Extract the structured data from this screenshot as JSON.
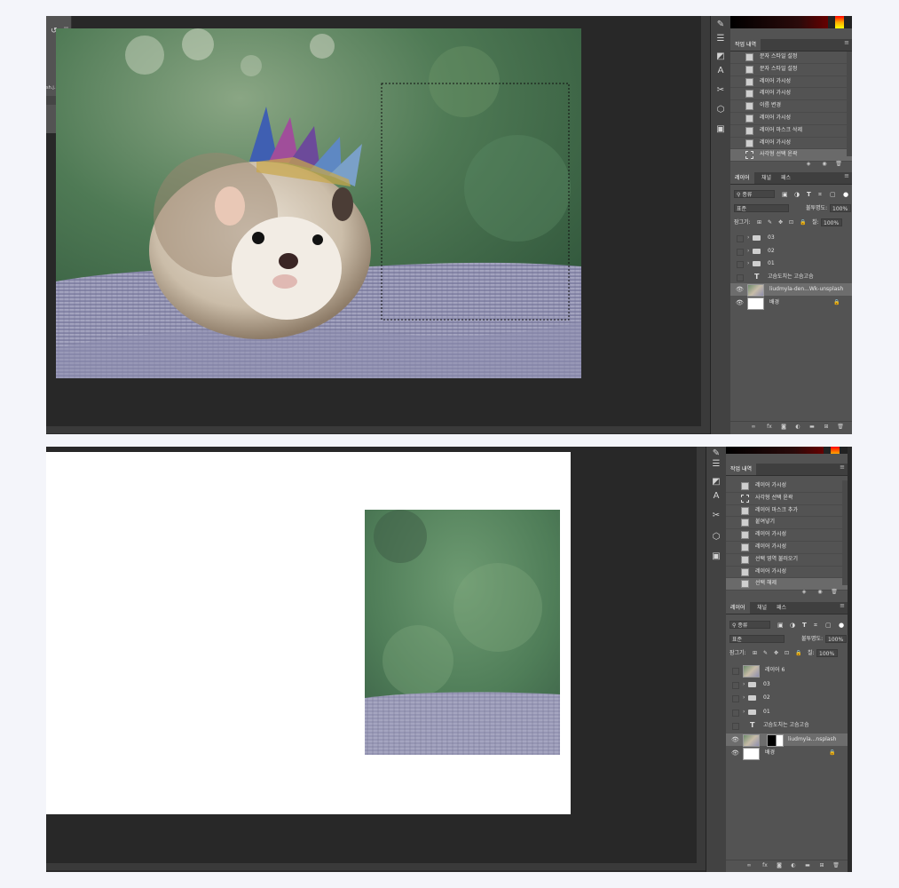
{
  "top": {
    "history_tab": "작업 내역",
    "history_items": [
      {
        "label": "문자 스타일 설정",
        "icon": "layer-icon"
      },
      {
        "label": "문자 스타일 설정",
        "icon": "layer-icon"
      },
      {
        "label": "레이어 가시성",
        "icon": "layer-icon"
      },
      {
        "label": "레이어 가시성",
        "icon": "layer-icon"
      },
      {
        "label": "이름 변경",
        "icon": "layer-icon"
      },
      {
        "label": "레이어 가시성",
        "icon": "layer-icon"
      },
      {
        "label": "레이어 마스크 삭제",
        "icon": "layer-icon"
      },
      {
        "label": "레이어 가시성",
        "icon": "layer-icon"
      },
      {
        "label": "사각형 선택 윤곽",
        "icon": "marquee-icon",
        "active": true
      }
    ],
    "layers_tabs": [
      "레이어",
      "채널",
      "패스"
    ],
    "filter_label": "종류",
    "blend_mode": "표준",
    "opacity_label": "불투명도:",
    "opacity_value": "100%",
    "lock_label": "잠그기:",
    "fill_label": "칠:",
    "fill_value": "100%",
    "layers": [
      {
        "name": "03",
        "kind": "group"
      },
      {
        "name": "02",
        "kind": "group"
      },
      {
        "name": "01",
        "kind": "group"
      },
      {
        "name": "고슴도치는 고슴고슴",
        "kind": "text"
      },
      {
        "name": "liudmyla-den...Wk-unsplash",
        "kind": "image",
        "active": true
      },
      {
        "name": "배경",
        "kind": "background"
      }
    ],
    "doc_tab_fragment": "sh.j..."
  },
  "bottom": {
    "history_tab": "작업 내역",
    "history_items": [
      {
        "label": "레이어 가시성",
        "icon": "layer-icon"
      },
      {
        "label": "사각형 선택 윤곽",
        "icon": "marquee-icon"
      },
      {
        "label": "레이어 마스크 추가",
        "icon": "layer-icon"
      },
      {
        "label": "붙여넣기",
        "icon": "layer-icon"
      },
      {
        "label": "레이어 가시성",
        "icon": "layer-icon"
      },
      {
        "label": "레이어 가시성",
        "icon": "layer-icon"
      },
      {
        "label": "선택 영역 불러오기",
        "icon": "layer-icon"
      },
      {
        "label": "레이어 가시성",
        "icon": "layer-icon"
      },
      {
        "label": "선택 해제",
        "icon": "layer-icon",
        "active": true
      }
    ],
    "layers_tabs": [
      "레이어",
      "채널",
      "패스"
    ],
    "filter_label": "종류",
    "blend_mode": "표준",
    "opacity_label": "불투명도:",
    "opacity_value": "100%",
    "lock_label": "잠그기:",
    "fill_label": "칠:",
    "fill_value": "100%",
    "layers": [
      {
        "name": "레이어 6",
        "kind": "image"
      },
      {
        "name": "03",
        "kind": "group"
      },
      {
        "name": "02",
        "kind": "group"
      },
      {
        "name": "01",
        "kind": "group"
      },
      {
        "name": "고슴도치는 고슴고슴",
        "kind": "text"
      },
      {
        "name": "liudmyla...nsplash",
        "kind": "image-mask",
        "active": true
      },
      {
        "name": "배경",
        "kind": "background"
      }
    ]
  },
  "colors": {
    "panel": "#535353",
    "workspace": "#282828",
    "active_row": "#6a6a6a",
    "page_bg": "#f4f5fa"
  }
}
